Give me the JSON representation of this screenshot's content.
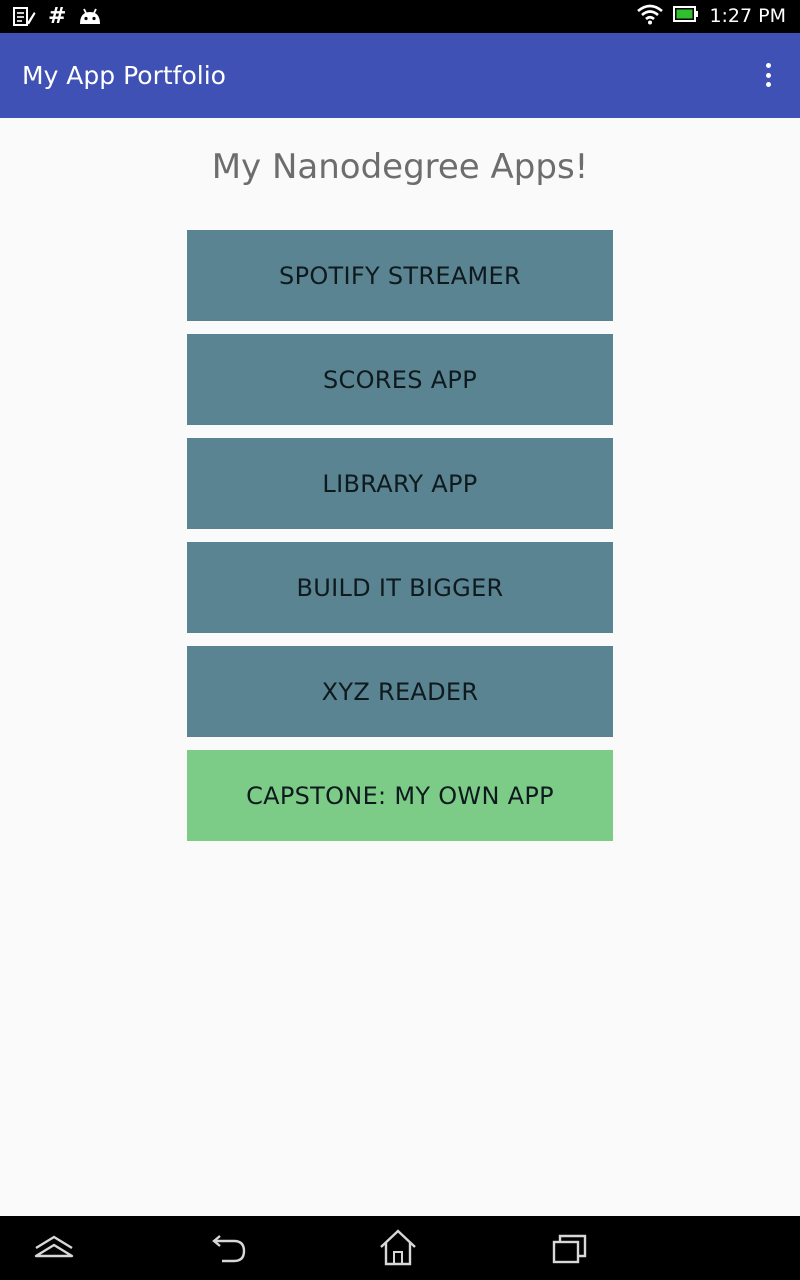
{
  "status_bar": {
    "time": "1:27 PM",
    "left_icons": [
      "notes-icon",
      "hash-icon",
      "android-icon"
    ],
    "hash_glyph": "#",
    "right_icons": [
      "wifi-icon",
      "battery-icon"
    ],
    "battery_color": "#2ec02e"
  },
  "app_bar": {
    "title": "My App Portfolio",
    "menu_icon": "more-vert-icon",
    "background": "#3f51b5"
  },
  "main": {
    "heading": "My Nanodegree Apps!",
    "buttons": [
      {
        "label": "SPOTIFY STREAMER",
        "color": "#5a8491"
      },
      {
        "label": "SCORES APP",
        "color": "#5a8491"
      },
      {
        "label": "LIBRARY APP",
        "color": "#5a8491"
      },
      {
        "label": "BUILD IT BIGGER",
        "color": "#5a8491"
      },
      {
        "label": "XYZ READER",
        "color": "#5a8491"
      },
      {
        "label": "CAPSTONE: MY OWN APP",
        "color": "#7ccc87"
      }
    ]
  },
  "nav_bar": {
    "icons": [
      "collapse-icon",
      "back-icon",
      "home-icon",
      "recents-icon"
    ]
  }
}
